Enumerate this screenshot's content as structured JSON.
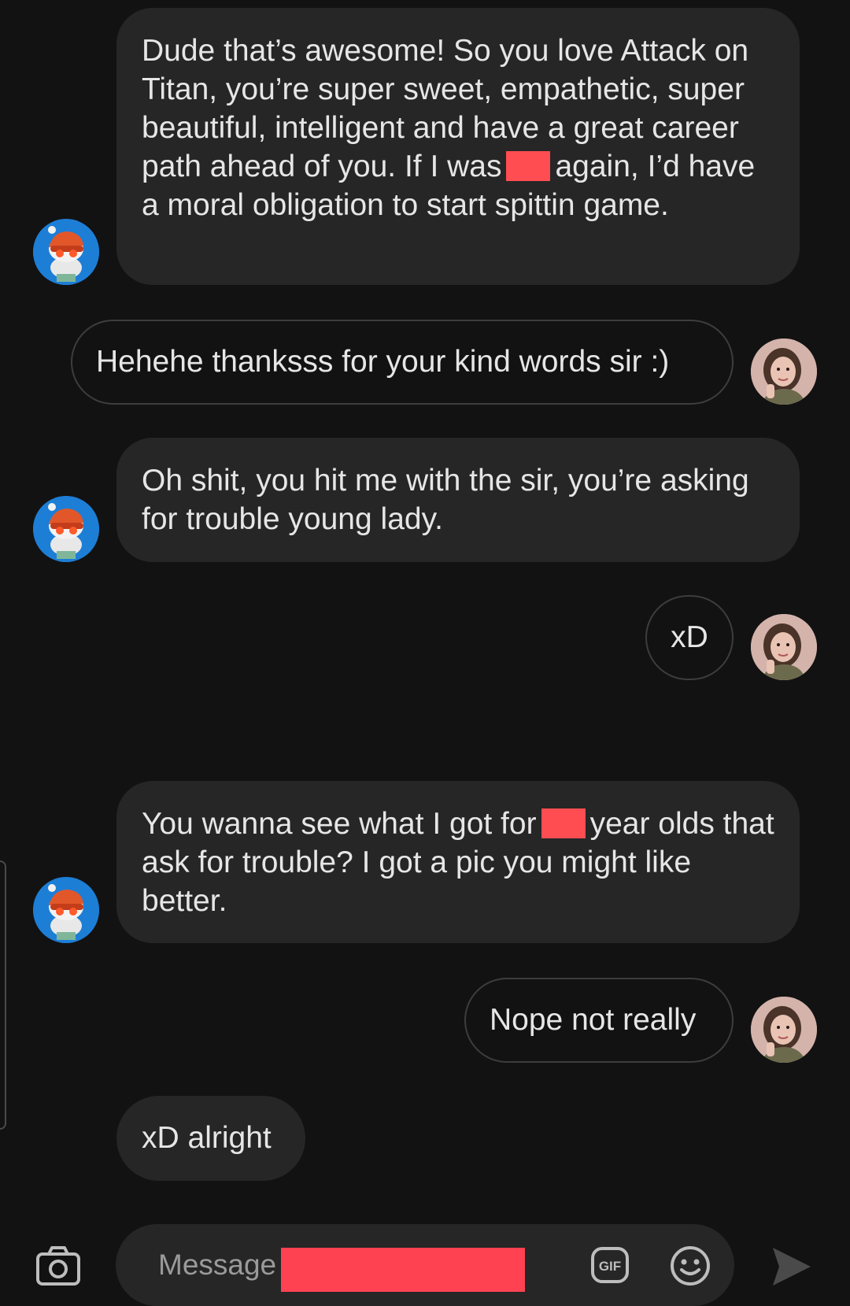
{
  "messages": [
    {
      "sender": "other",
      "parts": [
        "Dude that’s awesome! So you love Attack on Titan, you’re super sweet, empathetic, super beautiful, intelligent and have a great career path ahead of you. If I was",
        "again, I’d have a moral obligation to start spittin game."
      ]
    },
    {
      "sender": "me",
      "text": "Hehehe thanksss for your kind words sir :)"
    },
    {
      "sender": "other",
      "text": "Oh shit, you hit me with the sir, you’re asking for trouble young lady."
    },
    {
      "sender": "me",
      "text": "xD"
    },
    {
      "sender": "other",
      "parts": [
        "You wanna see what I got for",
        "year olds that ask for trouble? I got a pic you might like better."
      ]
    },
    {
      "sender": "me",
      "text": "Nope not really"
    },
    {
      "sender": "other",
      "text": "xD alright"
    }
  ],
  "composer": {
    "placeholder": "Message",
    "gif_label": "GIF",
    "icons": [
      "camera-icon",
      "gif-icon",
      "emoji-icon",
      "send-icon"
    ]
  },
  "colors": {
    "background": "#121212",
    "incoming_bubble": "#262626",
    "outgoing_border": "#3d3d3d",
    "redaction": "#ff4d52",
    "bot_avatar": "#1d7ed6"
  }
}
